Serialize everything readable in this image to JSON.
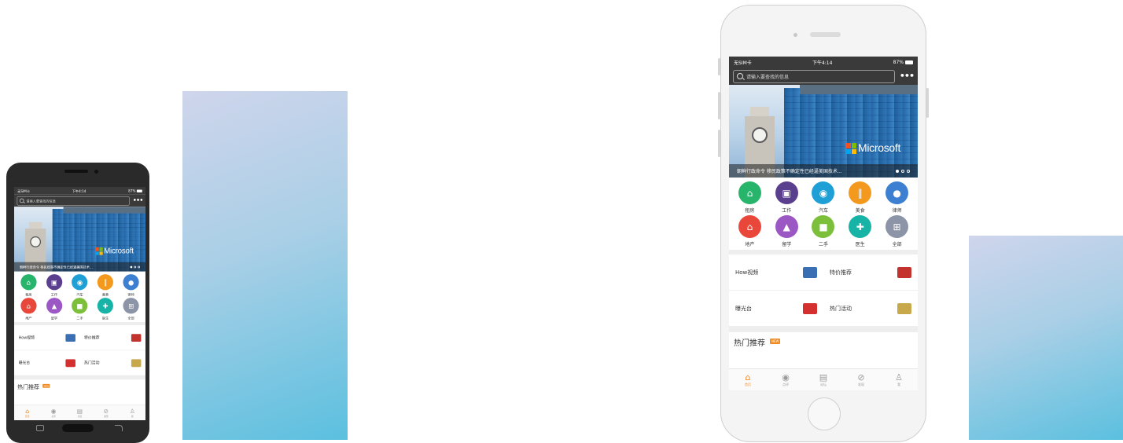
{
  "status": {
    "carrier": "无SIM卡",
    "time": "下午4:14",
    "battery": "87%"
  },
  "search": {
    "placeholder": "请输入要查找的信息",
    "more": "•••"
  },
  "banner": {
    "brand": "Microsoft",
    "caption": "朝鲜行政命令 移民政策不确定性已经逼美国技术..."
  },
  "categories": [
    {
      "label": "租房",
      "icon": "house-icon",
      "color": "#27b56c",
      "glyph": "⌂"
    },
    {
      "label": "工作",
      "icon": "briefcase-icon",
      "color": "#5b3f8f",
      "glyph": "▣"
    },
    {
      "label": "汽车",
      "icon": "car-icon",
      "color": "#1e9fd6",
      "glyph": "◉"
    },
    {
      "label": "美食",
      "icon": "fork-knife-icon",
      "color": "#f39a1e",
      "glyph": "‖"
    },
    {
      "label": "律师",
      "icon": "person-icon",
      "color": "#3d7fd0",
      "glyph": "●"
    },
    {
      "label": "地产",
      "icon": "home-icon",
      "color": "#e9473a",
      "glyph": "⌂"
    },
    {
      "label": "留学",
      "icon": "graduation-cap-icon",
      "color": "#9b57c3",
      "glyph": "▲"
    },
    {
      "label": "二手",
      "icon": "bag-icon",
      "color": "#7bbf3a",
      "glyph": "■"
    },
    {
      "label": "医生",
      "icon": "medical-cross-icon",
      "color": "#17b3a6",
      "glyph": "✚"
    },
    {
      "label": "全部",
      "icon": "grid-icon",
      "color": "#8c94a8",
      "glyph": "⊞"
    }
  ],
  "promos": [
    {
      "label": "How视频",
      "icon": "video-cards-icon",
      "color": "#3b6fb3"
    },
    {
      "label": "特价推荐",
      "icon": "award-badge-icon",
      "color": "#c4322e"
    },
    {
      "label": "曝光台",
      "icon": "exposure-icon",
      "color": "#d43030"
    },
    {
      "label": "热门活动",
      "icon": "palm-tree-icon",
      "color": "#c7a84a"
    }
  ],
  "hot": {
    "title": "热门推荐",
    "badge": "NEW"
  },
  "tabs": [
    {
      "label": "首页",
      "icon": "home-icon",
      "glyph": "⌂",
      "active": true
    },
    {
      "label": "点评",
      "icon": "target-icon",
      "glyph": "◉"
    },
    {
      "label": "论坛",
      "icon": "forum-icon",
      "glyph": "▤"
    },
    {
      "label": "发现",
      "icon": "compass-icon",
      "glyph": "⊘"
    },
    {
      "label": "我",
      "icon": "user-icon",
      "glyph": "♙"
    }
  ]
}
